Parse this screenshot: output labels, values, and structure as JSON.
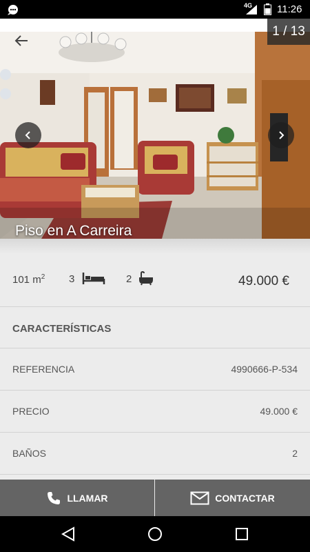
{
  "status_bar": {
    "network": "4G",
    "time": "11:26"
  },
  "gallery": {
    "counter": "1 / 13",
    "title": "Piso en A Carreira"
  },
  "summary": {
    "area_value": "101 m",
    "area_unit_sup": "2",
    "bedrooms": "3",
    "bathrooms": "2",
    "price": "49.000 €"
  },
  "section_title": "CARACTERÍSTICAS",
  "features": [
    {
      "label": "REFERENCIA",
      "value": "4990666-P-534"
    },
    {
      "label": "PRECIO",
      "value": "49.000 €"
    },
    {
      "label": "BAÑOS",
      "value": "2"
    }
  ],
  "actions": {
    "call_label": "LLAMAR",
    "contact_label": "CONTACTAR"
  },
  "colors": {
    "action_bar": "#646464",
    "background": "#ececec",
    "text": "#555555"
  }
}
